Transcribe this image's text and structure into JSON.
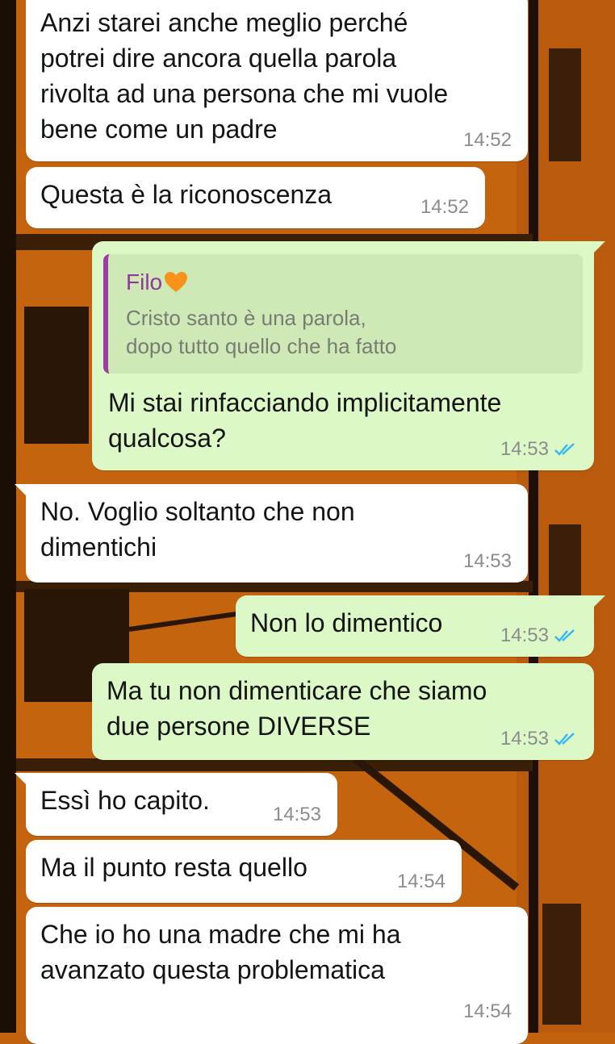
{
  "messages": [
    {
      "dir": "in",
      "text": "Anzi starei anche meglio perché\npotrei dire ancora quella parola\nrivolta ad una persona che mi vuole\nbene come un padre",
      "time": "14:52"
    },
    {
      "dir": "in",
      "text": "Questa è la riconoscenza",
      "time": "14:52"
    },
    {
      "dir": "out",
      "text": "Mi stai rinfacciando implicitamente\nqualcosa?",
      "time": "14:53",
      "read": true,
      "reply_to": {
        "author": "Filo",
        "text": "Cristo santo è una parola,\ndopo tutto quello che ha fatto"
      }
    },
    {
      "dir": "in",
      "text": "No. Voglio soltanto che non\ndimentichi",
      "time": "14:53"
    },
    {
      "dir": "out",
      "text": "Non lo dimentico",
      "time": "14:53",
      "read": true
    },
    {
      "dir": "out",
      "text": "Ma tu non dimenticare che siamo\ndue persone DIVERSE",
      "time": "14:53",
      "read": true
    },
    {
      "dir": "in",
      "text": "Essì ho capito.",
      "time": "14:53"
    },
    {
      "dir": "in",
      "text": "Ma il punto resta quello",
      "time": "14:54"
    },
    {
      "dir": "in",
      "text": "Che io ho una madre che mi ha\navanzato questa problematica",
      "time": "14:54"
    }
  ],
  "colors": {
    "incoming_bubble": "#ffffff",
    "outgoing_bubble": "#dcf8c6",
    "read_ticks": "#34b7f1",
    "quote_author": "#8e3a9c",
    "wallpaper": "#c2620e"
  },
  "icons": {
    "read_receipt": "double-check-icon",
    "emoji": "orange-heart-icon"
  }
}
